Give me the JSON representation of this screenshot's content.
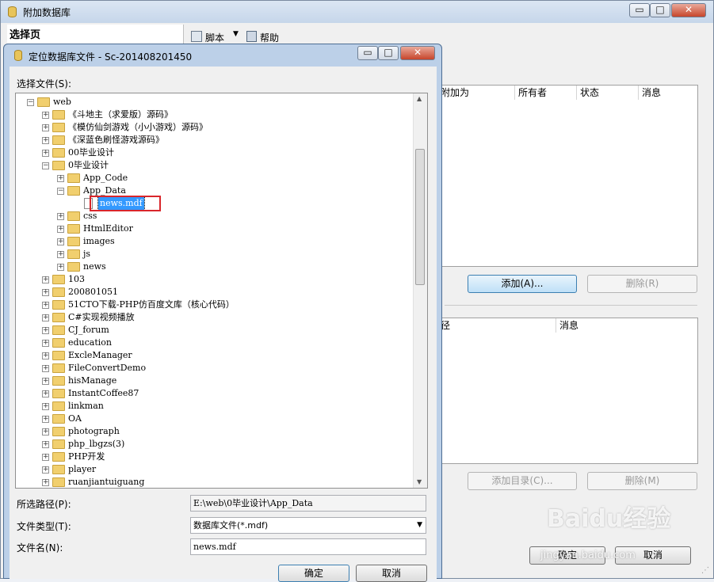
{
  "outer": {
    "title": "附加数据库",
    "controls": [
      "▭",
      "□",
      "✕"
    ],
    "left_panel_title": "选择页",
    "toolbar": {
      "script": "脚本",
      "help": "帮助"
    },
    "grid1": {
      "columns": [
        "附加为",
        "所有者",
        "状态",
        "消息"
      ]
    },
    "add_button": "添加(A)...",
    "remove_button": "删除(R)",
    "grid2": {
      "columns": [
        "径",
        "消息"
      ]
    },
    "add_catalog_button": "添加目录(C)...",
    "remove2_button": "删除(M)",
    "ok_button": "确定",
    "cancel_button": "取消"
  },
  "dialog": {
    "title": "定位数据库文件 - Sc-201408201450",
    "controls": [
      "▭",
      "□",
      "✕"
    ],
    "select_file_label": "选择文件(S):",
    "tree": [
      {
        "label": "web",
        "level": 0,
        "type": "folder",
        "expanded": true
      },
      {
        "label": "《斗地主（求爱版）源码》",
        "level": 1,
        "type": "folder"
      },
      {
        "label": "《模仿仙剑游戏（小小游戏）源码》",
        "level": 1,
        "type": "folder"
      },
      {
        "label": "《深蓝色刷怪游戏源码》",
        "level": 1,
        "type": "folder"
      },
      {
        "label": "00毕业设计",
        "level": 1,
        "type": "folder"
      },
      {
        "label": "0毕业设计",
        "level": 1,
        "type": "folder",
        "expanded": true
      },
      {
        "label": "App_Code",
        "level": 2,
        "type": "folder"
      },
      {
        "label": "App_Data",
        "level": 2,
        "type": "folder",
        "expanded": true
      },
      {
        "label": "news.mdf",
        "level": 3,
        "type": "file",
        "selected": true
      },
      {
        "label": "css",
        "level": 2,
        "type": "folder"
      },
      {
        "label": "HtmlEditor",
        "level": 2,
        "type": "folder"
      },
      {
        "label": "images",
        "level": 2,
        "type": "folder"
      },
      {
        "label": "js",
        "level": 2,
        "type": "folder"
      },
      {
        "label": "news",
        "level": 2,
        "type": "folder"
      },
      {
        "label": "103",
        "level": 1,
        "type": "folder"
      },
      {
        "label": "200801051",
        "level": 1,
        "type": "folder"
      },
      {
        "label": "51CTO下载-PHP仿百度文库（核心代码）",
        "level": 1,
        "type": "folder"
      },
      {
        "label": "C#实现视频播放",
        "level": 1,
        "type": "folder"
      },
      {
        "label": "CJ_forum",
        "level": 1,
        "type": "folder"
      },
      {
        "label": "education",
        "level": 1,
        "type": "folder"
      },
      {
        "label": "ExcleManager",
        "level": 1,
        "type": "folder"
      },
      {
        "label": "FileConvertDemo",
        "level": 1,
        "type": "folder"
      },
      {
        "label": "hisManage",
        "level": 1,
        "type": "folder"
      },
      {
        "label": "InstantCoffee87",
        "level": 1,
        "type": "folder"
      },
      {
        "label": "linkman",
        "level": 1,
        "type": "folder"
      },
      {
        "label": "OA",
        "level": 1,
        "type": "folder"
      },
      {
        "label": "photograph",
        "level": 1,
        "type": "folder"
      },
      {
        "label": "php_lbgzs(3)",
        "level": 1,
        "type": "folder"
      },
      {
        "label": "PHP开发",
        "level": 1,
        "type": "folder"
      },
      {
        "label": "player",
        "level": 1,
        "type": "folder"
      },
      {
        "label": "ruanjiantuiguang",
        "level": 1,
        "type": "folder"
      }
    ],
    "path_label": "所选路径(P):",
    "path_value": "E:\\web\\0毕业设计\\App_Data",
    "filetype_label": "文件类型(T):",
    "filetype_value": "数据库文件(*.mdf)",
    "filename_label": "文件名(N):",
    "filename_value": "news.mdf",
    "ok_button": "确定",
    "cancel_button": "取消"
  },
  "watermark": {
    "brand": "Baidu经验",
    "url": "jingyan.baidu.com"
  },
  "colors": {
    "selection": "#3399ff",
    "highlight_box": "#d9262b",
    "folder": "#f1cf6e"
  }
}
